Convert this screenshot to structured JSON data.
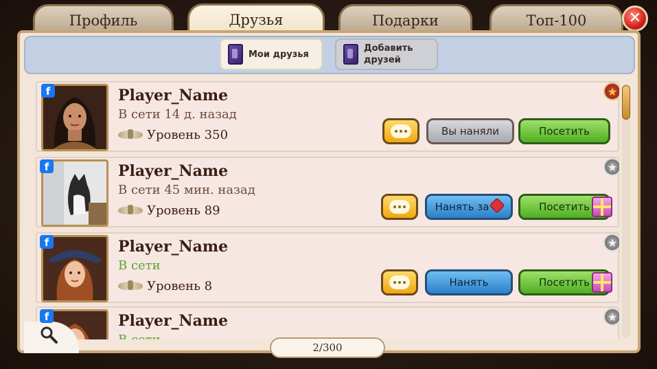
{
  "tabs": [
    {
      "label": "Профиль",
      "active": false
    },
    {
      "label": "Друзья",
      "active": true
    },
    {
      "label": "Подарки",
      "active": false
    },
    {
      "label": "Топ-100",
      "active": false
    }
  ],
  "subtabs": [
    {
      "label": "Мои друзья",
      "active": true
    },
    {
      "label": "Добавить друзей",
      "active": false
    }
  ],
  "friends": [
    {
      "name": "Player_Name",
      "status": "В сети 14 д. назад",
      "level": "Уровень 350",
      "hire_label": "Вы наняли",
      "hire_state": "hired",
      "visit_label": "Посетить",
      "star": "gold",
      "gift": false
    },
    {
      "name": "Player_Name",
      "status": "В сети 45 мин. назад",
      "level": "Уровень 89",
      "hire_label": "Нанять за",
      "hire_state": "hire-gem",
      "visit_label": "Посетить",
      "star": "grey",
      "gift": true
    },
    {
      "name": "Player_Name",
      "status": "В сети",
      "level": "Уровень 8",
      "hire_label": "Нанять",
      "hire_state": "hire",
      "visit_label": "Посетить",
      "star": "grey",
      "gift": true
    },
    {
      "name": "Player_Name",
      "status": "В сети",
      "star": "grey"
    }
  ],
  "pagination": {
    "text": "2/300"
  },
  "colors": {
    "online": "#5aa52f",
    "hire_blue": "#2c80c8",
    "visit_green": "#4fae23"
  }
}
